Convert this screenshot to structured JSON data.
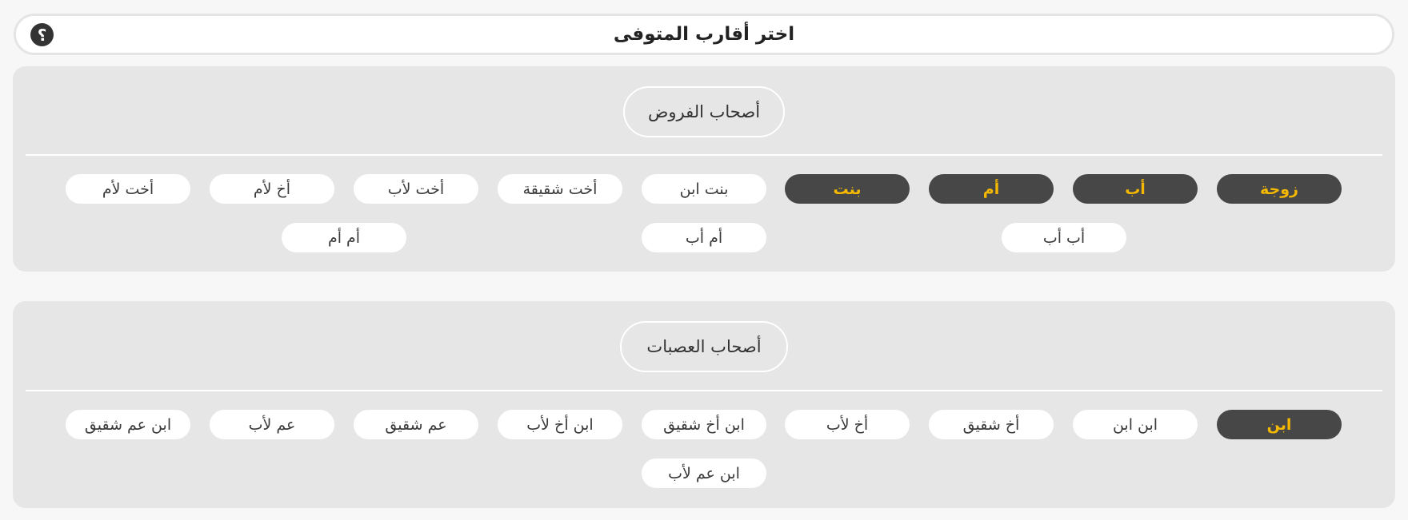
{
  "header": {
    "title": "اختر أقارب المتوفى",
    "help_symbol": "؟",
    "help_icon": "question-mark-icon"
  },
  "colors": {
    "panel": "#e6e6e6",
    "selected_bg": "#474747",
    "selected_text": "#f5b800",
    "chip_bg": "#ffffff"
  },
  "furud": {
    "label": "أصحاب الفروض",
    "items": [
      {
        "label": "زوجة",
        "selected": true
      },
      {
        "label": "أب",
        "selected": true
      },
      {
        "label": "أم",
        "selected": true
      },
      {
        "label": "بنت",
        "selected": true
      },
      {
        "label": "بنت ابن",
        "selected": false
      },
      {
        "label": "أخت شقيقة",
        "selected": false
      },
      {
        "label": "أخت لأب",
        "selected": false
      },
      {
        "label": "أخ لأم",
        "selected": false
      },
      {
        "label": "أخت لأم",
        "selected": false
      },
      {
        "label": "أب أب",
        "selected": false
      },
      {
        "label": "أم أب",
        "selected": false
      },
      {
        "label": "أم أم",
        "selected": false
      }
    ]
  },
  "asabat": {
    "label": "أصحاب العصبات",
    "items": [
      {
        "label": "ابن",
        "selected": true
      },
      {
        "label": "ابن ابن",
        "selected": false
      },
      {
        "label": "أخ شقيق",
        "selected": false
      },
      {
        "label": "أخ لأب",
        "selected": false
      },
      {
        "label": "ابن أخ شقيق",
        "selected": false
      },
      {
        "label": "ابن أخ لأب",
        "selected": false
      },
      {
        "label": "عم شقيق",
        "selected": false
      },
      {
        "label": "عم لأب",
        "selected": false
      },
      {
        "label": "ابن عم شقيق",
        "selected": false
      },
      {
        "label": "ابن عم لأب",
        "selected": false
      }
    ]
  }
}
